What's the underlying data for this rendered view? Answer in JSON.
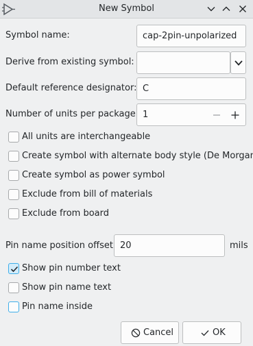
{
  "window": {
    "title": "New Symbol",
    "app_icon": "kicad-symbol-icon",
    "controls": [
      "chevron-down-icon",
      "chevron-up-icon",
      "close-icon"
    ]
  },
  "form": {
    "symbol_name": {
      "label": "Symbol name:",
      "value": "cap-2pin-unpolarized"
    },
    "derive": {
      "label": "Derive from existing symbol:",
      "value": ""
    },
    "designator": {
      "label": "Default reference designator:",
      "value": "C"
    },
    "units": {
      "label": "Number of units per package:",
      "value": "1",
      "minus": "—",
      "plus": "+"
    }
  },
  "options": [
    {
      "label": "All units are interchangeable",
      "checked": false
    },
    {
      "label": "Create symbol with alternate body style (De Morgan)",
      "checked": false
    },
    {
      "label": "Create symbol as power symbol",
      "checked": false
    },
    {
      "label": "Exclude from bill of materials",
      "checked": false
    },
    {
      "label": "Exclude from board",
      "checked": false
    }
  ],
  "pin": {
    "offset": {
      "label": "Pin name position offset:",
      "value": "20",
      "unit": "mils"
    },
    "show_number": {
      "label": "Show pin number text",
      "checked": true
    },
    "show_name": {
      "label": "Show pin name text",
      "checked": false
    },
    "inside": {
      "label": "Pin name inside",
      "checked": false
    }
  },
  "buttons": {
    "cancel": "Cancel",
    "ok": "OK"
  },
  "colors": {
    "accent": "#3daee9",
    "background": "#eff0f1",
    "titlebar": "#e3e5e7"
  }
}
